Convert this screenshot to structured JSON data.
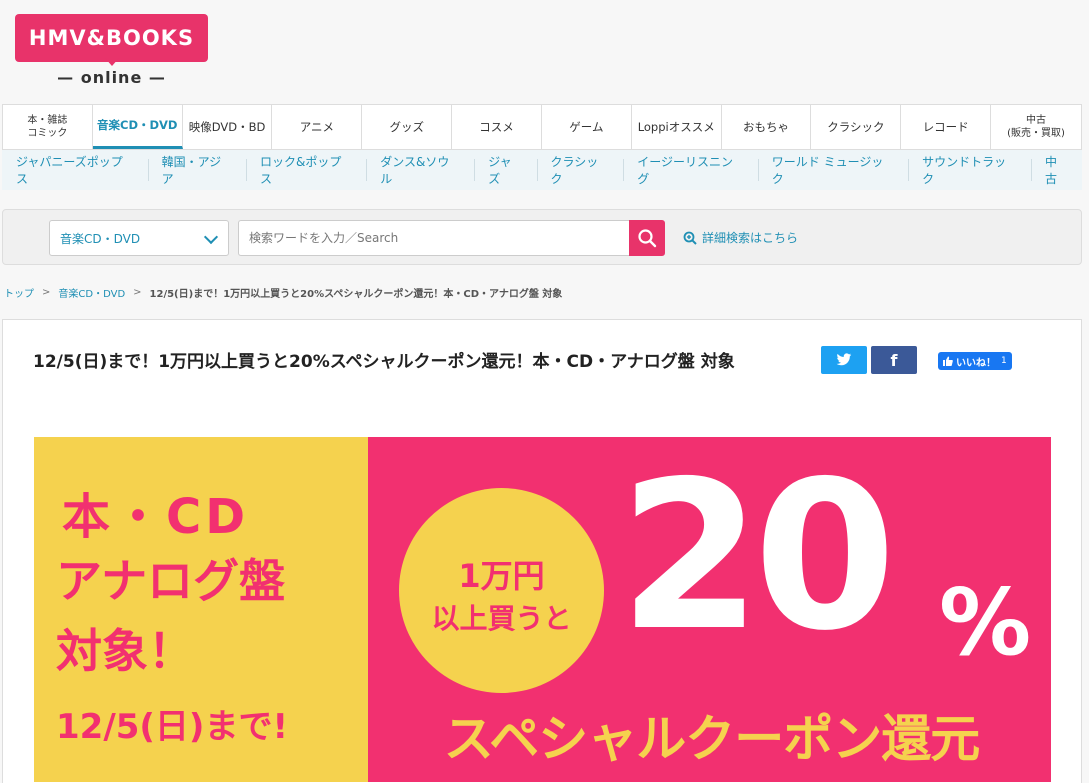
{
  "logo": {
    "text": "HMV&BOOKS",
    "sub": "— online —"
  },
  "main_nav": [
    {
      "label": "本・雑誌\nコミック",
      "small": true
    },
    {
      "label": "音楽CD・DVD",
      "active": true
    },
    {
      "label": "映像DVD・BD"
    },
    {
      "label": "アニメ"
    },
    {
      "label": "グッズ"
    },
    {
      "label": "コスメ"
    },
    {
      "label": "ゲーム"
    },
    {
      "label": "Loppiオススメ"
    },
    {
      "label": "おもちゃ"
    },
    {
      "label": "クラシック"
    },
    {
      "label": "レコード"
    },
    {
      "label": "中古\n(販売・買取)",
      "small": true
    }
  ],
  "sub_nav": [
    "ジャパニーズポップス",
    "韓国・アジア",
    "ロック&ポップス",
    "ダンス&ソウル",
    "ジャズ",
    "クラシック",
    "イージーリスニング",
    "ワールド ミュージック",
    "サウンドトラック",
    "中古"
  ],
  "search": {
    "category": "音楽CD・DVD",
    "placeholder": "検索ワードを入力／Search",
    "advanced": "詳細検索はこちら"
  },
  "breadcrumb": {
    "home": "トップ",
    "category": "音楽CD・DVD",
    "current": "12/5(日)まで！1万円以上買うと20%スペシャルクーポン還元！本・CD・アナログ盤 対象",
    "separator": ">"
  },
  "article": {
    "title": "12/5(日)まで！1万円以上買うと20%スペシャルクーポン還元！本・CD・アナログ盤 対象",
    "facebook_label": "f",
    "like_label": "いいね！",
    "like_count": "1"
  },
  "banner": {
    "left_line1": "本・CD",
    "left_line2": "アナログ盤",
    "left_line3": "対象！",
    "date": "12/5(日)まで!",
    "circle_line1": "1万円",
    "circle_line2": "以上買うと",
    "big_number": "20",
    "percent": "%",
    "bottom": "スペシャルクーポン還元"
  },
  "colors": {
    "brand_pink": "#e8336a",
    "link_blue": "#1f8fb4",
    "banner_yellow": "#f5d24e",
    "banner_pink": "#f23070"
  }
}
